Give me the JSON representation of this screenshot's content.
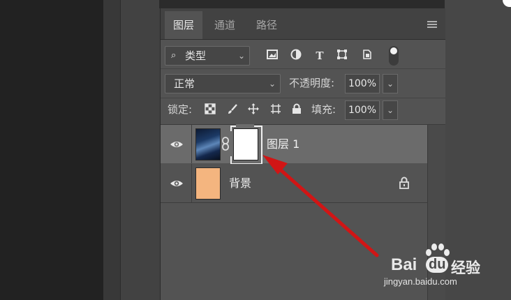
{
  "layers_panel": {
    "tabs": [
      {
        "label": "图层",
        "active": true
      },
      {
        "label": "通道",
        "active": false
      },
      {
        "label": "路径",
        "active": false
      }
    ],
    "filter": {
      "type_label": "类型"
    },
    "blend_mode": "正常",
    "opacity_label": "不透明度:",
    "opacity_value": "100%",
    "lock_label": "锁定:",
    "fill_label": "填充:",
    "fill_value": "100%",
    "layers": [
      {
        "name": "图层 1",
        "selected": true,
        "visible": true,
        "has_mask": true
      },
      {
        "name": "背景",
        "selected": false,
        "visible": true,
        "locked": true
      }
    ]
  },
  "colors": {
    "panel_bg": "#535353",
    "selected_row": "#6b6b6b",
    "arrow": "#d11515",
    "background_thumb": "#f4b57f"
  },
  "watermark": {
    "brand": "Bai",
    "brand_du": "du",
    "brand_suffix": "经验",
    "url": "jingyan.baidu.com"
  }
}
